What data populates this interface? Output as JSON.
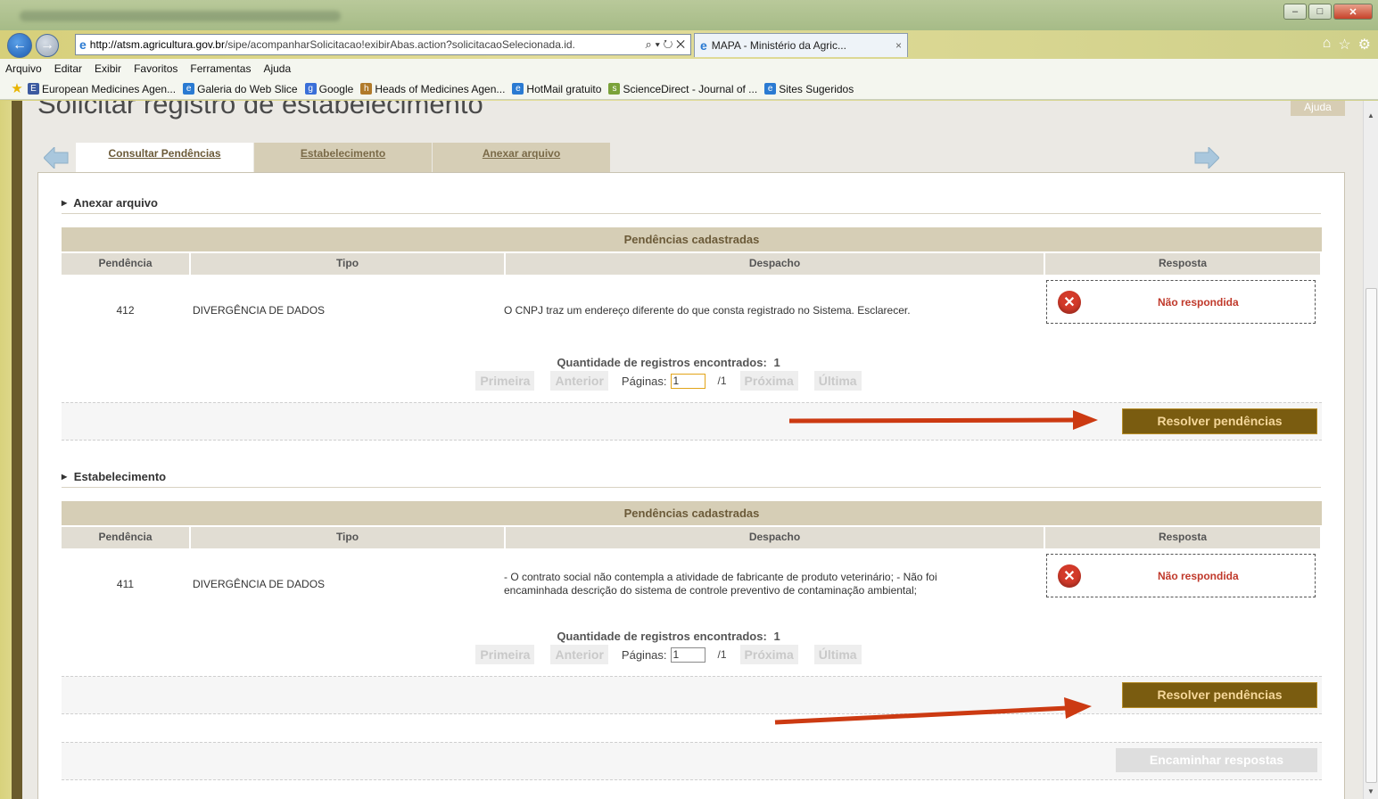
{
  "browser": {
    "url_domain": "http://atsm.agricultura.gov.br",
    "url_path": "/sipe/acompanharSolicitacao!exibirAbas.action?solicitacaoSelecionada.id.",
    "address_tools": "⌕ ▾ ↻ ✕",
    "tab_title": "MAPA - Ministério da Agric...",
    "tab_close": "×",
    "menu": [
      "Arquivo",
      "Editar",
      "Exibir",
      "Favoritos",
      "Ferramentas",
      "Ajuda"
    ],
    "favorites": [
      "European Medicines Agen...",
      "Galeria do Web Slice",
      "Google",
      "Heads of Medicines Agen...",
      "HotMail gratuito",
      "ScienceDirect - Journal of ...",
      "Sites Sugeridos"
    ],
    "colors": {
      "nav_active": "#1d5cb0"
    }
  },
  "page": {
    "title": "Solicitar registro de estabelecimento",
    "help_label": "Ajuda",
    "tabs": [
      "Consultar Pendências",
      "Estabelecimento",
      "Anexar arquivo"
    ],
    "active_tab": "Consultar Pendências",
    "colors": {
      "tab_bg": "#d6ceb6",
      "button_bg": "#7a5c10",
      "annotation_arrow": "#cc3a12",
      "status_red": "#c0392b"
    }
  },
  "table_headers": {
    "caption": "Pendências cadastradas",
    "columns": [
      "Pendência",
      "Tipo",
      "Despacho",
      "Resposta"
    ]
  },
  "sections": [
    {
      "title": "Anexar arquivo",
      "rows": [
        {
          "pendencia": "412",
          "tipo": "DIVERGÊNCIA DE DADOS",
          "despacho": "O CNPJ traz um endereço diferente do que consta registrado no Sistema. Esclarecer.",
          "resposta": "Não respondida"
        }
      ],
      "pager": {
        "count_label": "Quantidade de registros encontrados:",
        "count": "1",
        "first": "Primeira",
        "prev": "Anterior",
        "pages_label": "Páginas:",
        "page_value": "1",
        "total": "/1",
        "next": "Próxima",
        "last": "Última"
      },
      "action_label": "Resolver pendências"
    },
    {
      "title": "Estabelecimento",
      "rows": [
        {
          "pendencia": "411",
          "tipo": "DIVERGÊNCIA DE DADOS",
          "despacho": "- O contrato social não contempla a atividade de fabricante de produto veterinário; - Não foi encaminhada descrição do sistema de controle preventivo de contaminação ambiental;",
          "resposta": "Não respondida"
        }
      ],
      "pager": {
        "count_label": "Quantidade de registros encontrados:",
        "count": "1",
        "first": "Primeira",
        "prev": "Anterior",
        "pages_label": "Páginas:",
        "page_value": "1",
        "total": "/1",
        "next": "Próxima",
        "last": "Última"
      },
      "action_label": "Resolver pendências"
    }
  ],
  "submit_label": "Encaminhar respostas",
  "icons": [
    "back-arrow-icon",
    "forward-arrow-icon",
    "ie-logo-icon",
    "home-icon",
    "star-icon",
    "gear-icon",
    "error-x-icon",
    "prev-page-arrow-icon",
    "next-page-arrow-icon"
  ]
}
